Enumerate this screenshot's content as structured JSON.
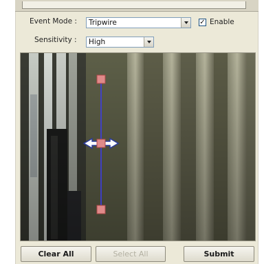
{
  "event_mode": {
    "label": "Event Mode :",
    "value": "Tripwire",
    "enable_label": "Enable",
    "enable_checked": "✓"
  },
  "sensitivity": {
    "label": "Sensitivity :",
    "value": "High"
  },
  "buttons": {
    "clear_all": "Clear All",
    "select_all": "Select All",
    "submit": "Submit"
  },
  "colors": {
    "tripwire_line": "#3c3cf0",
    "handle_fill": "#e08a8a",
    "panel_bg": "#ece9d8"
  }
}
